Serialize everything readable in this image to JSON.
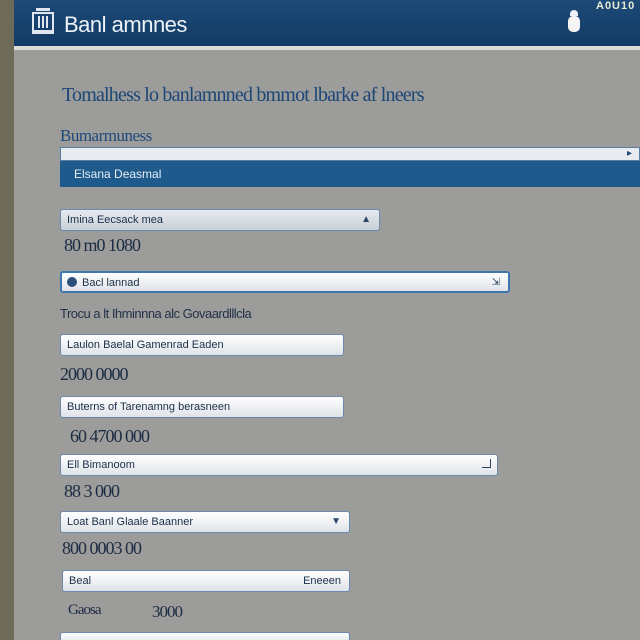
{
  "header": {
    "title": "Banl amnnes",
    "top_right": "A0U10"
  },
  "page": {
    "heading": "Tomalhess lo banlamnned bmmot lbarke af lneers",
    "subheading": "Bumarmuness",
    "selected_row": "Elsana Deasmal"
  },
  "fields": {
    "account_type": {
      "value": "Imina Eecsack mea",
      "amount": "80 m0 1080"
    },
    "search": {
      "value": "Bacl lannad"
    },
    "section_label": "Trocu a lt Ihminnna alc Govaardlllcla",
    "option1": {
      "value": "Laulon Baelal Gamenrad Eaden",
      "amount": "2000 0000"
    },
    "option2": {
      "value": "Buterns of Tarenamng berasneen",
      "amount": "60 4700 000"
    },
    "option3": {
      "value": "Ell Bimanoom",
      "amount": "88 3 000"
    },
    "option4": {
      "value": "Loat Banl Glaale Baanner",
      "amount": "800 0003 00"
    },
    "option5": {
      "value": "Beal",
      "right": "Eneeen"
    },
    "total": {
      "label": "Gaosa",
      "amount": "3000"
    }
  }
}
